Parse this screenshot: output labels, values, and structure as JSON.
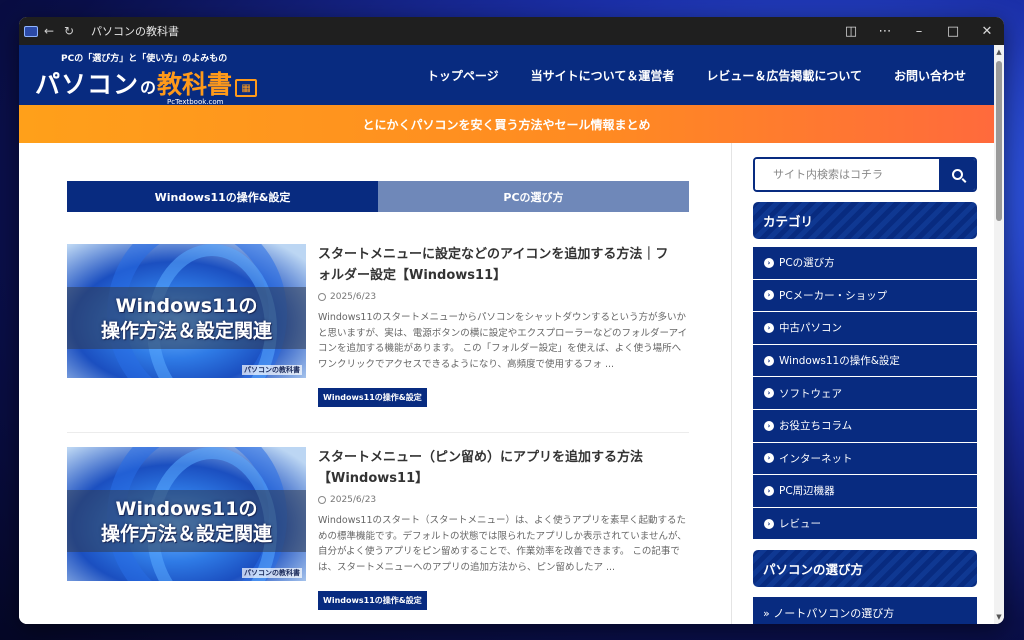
{
  "browser": {
    "title": "パソコンの教科書"
  },
  "header": {
    "tagline": "PCの「選び方」と「使い方」のよみもの",
    "logo_part1": "パソコン",
    "logo_part2": "の",
    "logo_part3": "教科書",
    "logo_url": "PcTextbook.com",
    "nav": [
      {
        "label": "トップページ"
      },
      {
        "label": "当サイトについて＆運営者"
      },
      {
        "label": "レビュー＆広告掲載について"
      },
      {
        "label": "お問い合わせ"
      }
    ]
  },
  "banner": {
    "text": "とにかくパソコンを安く買う方法やセール情報まとめ"
  },
  "tabs": [
    {
      "label": "Windows11の操作&設定"
    },
    {
      "label": "PCの選び方"
    }
  ],
  "articles": [
    {
      "thumb_line1": "Windows11の",
      "thumb_line2": "操作方法＆設定関連",
      "thumb_watermark": "パソコンの教科書",
      "title": "スタートメニューに設定などのアイコンを追加する方法｜フォルダー設定【Windows11】",
      "date": "2025/6/23",
      "excerpt": "Windows11のスタートメニューからパソコンをシャットダウンするという方が多いかと思いますが、実は、電源ボタンの横に設定やエクスプローラーなどのフォルダーアイコンを追加する機能があります。 この「フォルダー設定」を使えば、よく使う場所へワンクリックでアクセスできるようになり、高頻度で使用するフォ ...",
      "tag": "Windows11の操作&設定"
    },
    {
      "thumb_line1": "Windows11の",
      "thumb_line2": "操作方法＆設定関連",
      "thumb_watermark": "パソコンの教科書",
      "title": "スタートメニュー（ピン留め）にアプリを追加する方法【Windows11】",
      "date": "2025/6/23",
      "excerpt": "Windows11のスタート（スタートメニュー）は、よく使うアプリを素早く起動するための標準機能です。デフォルトの状態では限られたアプリしか表示されていませんが、自分がよく使うアプリをピン留めすることで、作業効率を改善できます。 この記事では、スタートメニューへのアプリの追加方法から、ピン留めしたア ...",
      "tag": "Windows11の操作&設定"
    }
  ],
  "sidebar": {
    "search_placeholder": "サイト内検索はコチラ",
    "category_title": "カテゴリ",
    "categories": [
      {
        "label": "PCの選び方"
      },
      {
        "label": "PCメーカー・ショップ"
      },
      {
        "label": "中古パソコン"
      },
      {
        "label": "Windows11の操作&設定"
      },
      {
        "label": "ソフトウェア"
      },
      {
        "label": "お役立ちコラム"
      },
      {
        "label": "インターネット"
      },
      {
        "label": "PC周辺機器"
      },
      {
        "label": "レビュー"
      }
    ],
    "pc_title": "パソコンの選び方",
    "pc_items": [
      {
        "label": "» ノートパソコンの選び方"
      }
    ]
  }
}
